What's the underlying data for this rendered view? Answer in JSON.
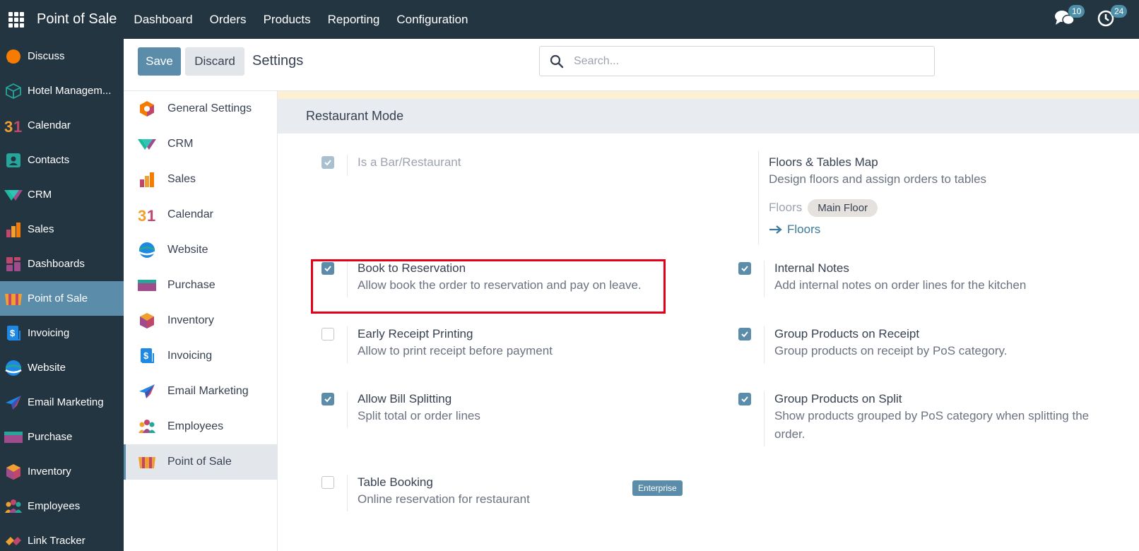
{
  "topbar": {
    "brand": "Point of Sale",
    "menu": [
      "Dashboard",
      "Orders",
      "Products",
      "Reporting",
      "Configuration"
    ],
    "messages_count": "10",
    "activities_count": "24"
  },
  "app_sidebar": {
    "items": [
      {
        "label": "Discuss",
        "icon": "discuss-icon"
      },
      {
        "label": "Hotel Managem...",
        "icon": "hotel-icon"
      },
      {
        "label": "Calendar",
        "icon": "calendar-icon"
      },
      {
        "label": "Contacts",
        "icon": "contacts-icon"
      },
      {
        "label": "CRM",
        "icon": "crm-icon"
      },
      {
        "label": "Sales",
        "icon": "sales-icon"
      },
      {
        "label": "Dashboards",
        "icon": "dashboards-icon"
      },
      {
        "label": "Point of Sale",
        "icon": "point-of-sale-icon",
        "active": true
      },
      {
        "label": "Invoicing",
        "icon": "invoicing-icon"
      },
      {
        "label": "Website",
        "icon": "website-icon"
      },
      {
        "label": "Email Marketing",
        "icon": "email-marketing-icon"
      },
      {
        "label": "Purchase",
        "icon": "purchase-icon"
      },
      {
        "label": "Inventory",
        "icon": "inventory-icon"
      },
      {
        "label": "Employees",
        "icon": "employees-icon"
      },
      {
        "label": "Link Tracker",
        "icon": "link-tracker-icon"
      }
    ]
  },
  "controls": {
    "save_label": "Save",
    "discard_label": "Discard",
    "title": "Settings",
    "search_placeholder": "Search..."
  },
  "settings_sidebar": {
    "items": [
      {
        "label": "General Settings",
        "icon": "general-settings-icon"
      },
      {
        "label": "CRM",
        "icon": "crm-icon"
      },
      {
        "label": "Sales",
        "icon": "sales-icon"
      },
      {
        "label": "Calendar",
        "icon": "calendar-icon"
      },
      {
        "label": "Website",
        "icon": "website-icon"
      },
      {
        "label": "Purchase",
        "icon": "purchase-icon"
      },
      {
        "label": "Inventory",
        "icon": "inventory-icon"
      },
      {
        "label": "Invoicing",
        "icon": "invoicing-icon"
      },
      {
        "label": "Email Marketing",
        "icon": "email-marketing-icon"
      },
      {
        "label": "Employees",
        "icon": "employees-icon"
      },
      {
        "label": "Point of Sale",
        "icon": "point-of-sale-icon",
        "active": true
      }
    ]
  },
  "section": {
    "title": "Restaurant Mode",
    "is_bar": {
      "label": "Is a Bar/Restaurant",
      "checked": true,
      "disabled": true
    },
    "floors_map": {
      "title": "Floors & Tables Map",
      "desc": "Design floors and assign orders to tables",
      "floors_label": "Floors",
      "floor_tag": "Main Floor",
      "floors_link": "Floors"
    },
    "book_reservation": {
      "title": "Book to Reservation",
      "desc": "Allow book the order to reservation and pay on leave.",
      "checked": true
    },
    "internal_notes": {
      "title": "Internal Notes",
      "desc": "Add internal notes on order lines for the kitchen",
      "checked": true
    },
    "early_receipt": {
      "title": "Early Receipt Printing",
      "desc": "Allow to print receipt before payment",
      "checked": false
    },
    "group_receipt": {
      "title": "Group Products on Receipt",
      "desc": "Group products on receipt by PoS category.",
      "checked": true
    },
    "bill_splitting": {
      "title": "Allow Bill Splitting",
      "desc": "Split total or order lines",
      "checked": true
    },
    "group_split": {
      "title": "Group Products on Split",
      "desc": "Show products grouped by PoS category when splitting the order.",
      "checked": true
    },
    "table_booking": {
      "title": "Table Booking",
      "desc": "Online reservation for restaurant",
      "checked": false,
      "badge": "Enterprise"
    }
  },
  "colors": {
    "navbar": "#243542",
    "accent": "#5b8ca9",
    "highlight": "#e5001a"
  }
}
